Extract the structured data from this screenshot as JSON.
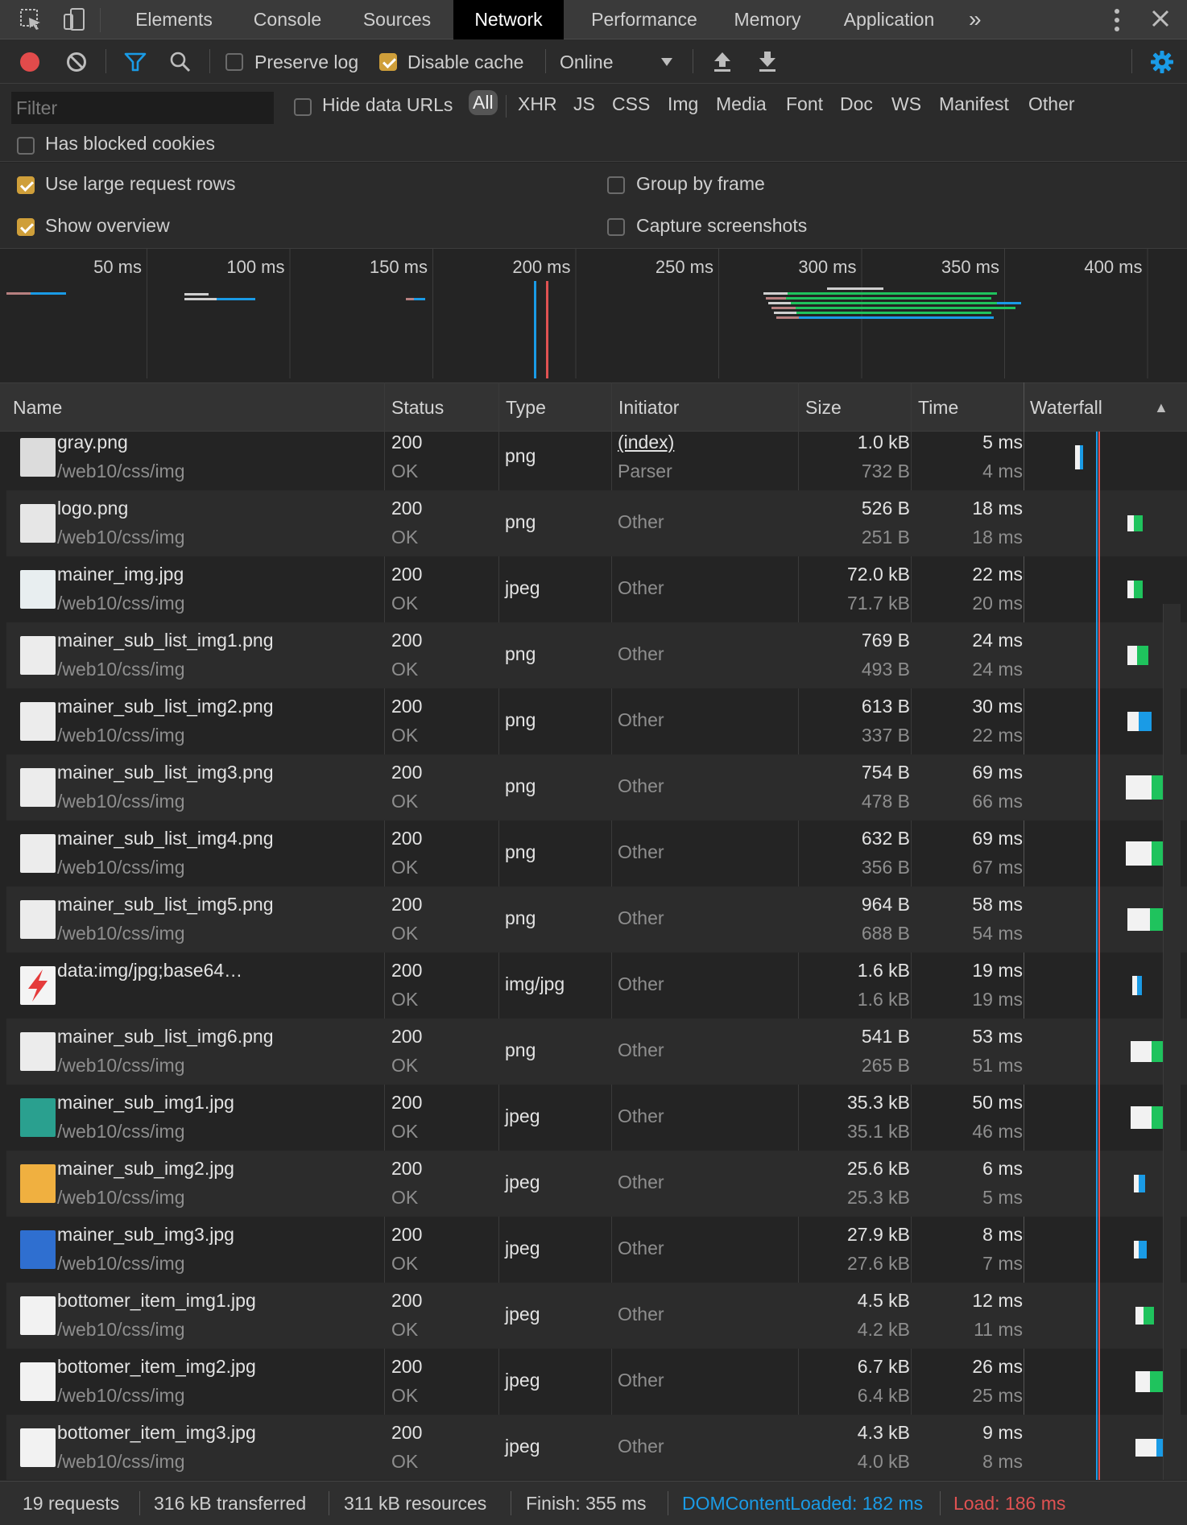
{
  "tabs": [
    "Elements",
    "Console",
    "Sources",
    "Network",
    "Performance",
    "Memory",
    "Application"
  ],
  "active_tab": "Network",
  "toolbar": {
    "preserve_log": {
      "label": "Preserve log",
      "checked": false
    },
    "disable_cache": {
      "label": "Disable cache",
      "checked": true
    },
    "throttling": "Online"
  },
  "filter": {
    "placeholder": "Filter",
    "hide_data_urls": {
      "label": "Hide data URLs",
      "checked": false
    },
    "types": [
      "All",
      "XHR",
      "JS",
      "CSS",
      "Img",
      "Media",
      "Font",
      "Doc",
      "WS",
      "Manifest",
      "Other"
    ],
    "active_type": "All",
    "has_blocked_cookies": {
      "label": "Has blocked cookies",
      "checked": false
    }
  },
  "settings": {
    "large_rows": {
      "label": "Use large request rows",
      "checked": true
    },
    "group_by_frame": {
      "label": "Group by frame",
      "checked": false
    },
    "show_overview": {
      "label": "Show overview",
      "checked": true
    },
    "capture_screenshots": {
      "label": "Capture screenshots",
      "checked": false
    }
  },
  "overview": {
    "tick_labels": [
      "50 ms",
      "100 ms",
      "150 ms",
      "200 ms",
      "250 ms",
      "300 ms",
      "350 ms",
      "400 ms"
    ],
    "dom_content_loaded_ms": 182,
    "load_ms": 186
  },
  "columns": [
    "Name",
    "Status",
    "Type",
    "Initiator",
    "Size",
    "Time",
    "Waterfall"
  ],
  "sort_indicator": "▲",
  "requests": [
    {
      "name": "gray.png",
      "path": "/web10/css/img",
      "status": "200",
      "status_text": "OK",
      "type": "png",
      "initiator": "(index)",
      "initiator_sub": "Parser",
      "size": "1.0 kB",
      "resource": "732 B",
      "time": "5 ms",
      "latency": "4 ms",
      "thumb": "#dcdcdc",
      "bar_color": "#1a9be6"
    },
    {
      "name": "logo.png",
      "path": "/web10/css/img",
      "status": "200",
      "status_text": "OK",
      "type": "png",
      "initiator": "Other",
      "initiator_sub": "",
      "size": "526 B",
      "resource": "251 B",
      "time": "18 ms",
      "latency": "18 ms",
      "thumb": "#e6e6e6",
      "bar_color": "#1fc35d"
    },
    {
      "name": "mainer_img.jpg",
      "path": "/web10/css/img",
      "status": "200",
      "status_text": "OK",
      "type": "jpeg",
      "initiator": "Other",
      "initiator_sub": "",
      "size": "72.0 kB",
      "resource": "71.7 kB",
      "time": "22 ms",
      "latency": "20 ms",
      "thumb": "#e8eef0",
      "bar_color": "#1fc35d"
    },
    {
      "name": "mainer_sub_list_img1.png",
      "path": "/web10/css/img",
      "status": "200",
      "status_text": "OK",
      "type": "png",
      "initiator": "Other",
      "initiator_sub": "",
      "size": "769 B",
      "resource": "493 B",
      "time": "24 ms",
      "latency": "24 ms",
      "thumb": "#ececec",
      "bar_color": "#1fc35d"
    },
    {
      "name": "mainer_sub_list_img2.png",
      "path": "/web10/css/img",
      "status": "200",
      "status_text": "OK",
      "type": "png",
      "initiator": "Other",
      "initiator_sub": "",
      "size": "613 B",
      "resource": "337 B",
      "time": "30 ms",
      "latency": "22 ms",
      "thumb": "#ececec",
      "bar_color": "#1a9be6"
    },
    {
      "name": "mainer_sub_list_img3.png",
      "path": "/web10/css/img",
      "status": "200",
      "status_text": "OK",
      "type": "png",
      "initiator": "Other",
      "initiator_sub": "",
      "size": "754 B",
      "resource": "478 B",
      "time": "69 ms",
      "latency": "66 ms",
      "thumb": "#ececec",
      "bar_color": "#1fc35d"
    },
    {
      "name": "mainer_sub_list_img4.png",
      "path": "/web10/css/img",
      "status": "200",
      "status_text": "OK",
      "type": "png",
      "initiator": "Other",
      "initiator_sub": "",
      "size": "632 B",
      "resource": "356 B",
      "time": "69 ms",
      "latency": "67 ms",
      "thumb": "#ececec",
      "bar_color": "#1fc35d"
    },
    {
      "name": "mainer_sub_list_img5.png",
      "path": "/web10/css/img",
      "status": "200",
      "status_text": "OK",
      "type": "png",
      "initiator": "Other",
      "initiator_sub": "",
      "size": "964 B",
      "resource": "688 B",
      "time": "58 ms",
      "latency": "54 ms",
      "thumb": "#ececec",
      "bar_color": "#1fc35d"
    },
    {
      "name": "data:img/jpg;base64…",
      "path": "",
      "status": "200",
      "status_text": "OK",
      "type": "img/jpg",
      "initiator": "Other",
      "initiator_sub": "",
      "size": "1.6 kB",
      "resource": "1.6 kB",
      "time": "19 ms",
      "latency": "19 ms",
      "thumb": "#f4f4f4",
      "bar_color": "#1a9be6"
    },
    {
      "name": "mainer_sub_list_img6.png",
      "path": "/web10/css/img",
      "status": "200",
      "status_text": "OK",
      "type": "png",
      "initiator": "Other",
      "initiator_sub": "",
      "size": "541 B",
      "resource": "265 B",
      "time": "53 ms",
      "latency": "51 ms",
      "thumb": "#ececec",
      "bar_color": "#1fc35d"
    },
    {
      "name": "mainer_sub_img1.jpg",
      "path": "/web10/css/img",
      "status": "200",
      "status_text": "OK",
      "type": "jpeg",
      "initiator": "Other",
      "initiator_sub": "",
      "size": "35.3 kB",
      "resource": "35.1 kB",
      "time": "50 ms",
      "latency": "46 ms",
      "thumb": "#2aa08f",
      "bar_color": "#1fc35d"
    },
    {
      "name": "mainer_sub_img2.jpg",
      "path": "/web10/css/img",
      "status": "200",
      "status_text": "OK",
      "type": "jpeg",
      "initiator": "Other",
      "initiator_sub": "",
      "size": "25.6 kB",
      "resource": "25.3 kB",
      "time": "6 ms",
      "latency": "5 ms",
      "thumb": "#f0b040",
      "bar_color": "#1a9be6"
    },
    {
      "name": "mainer_sub_img3.jpg",
      "path": "/web10/css/img",
      "status": "200",
      "status_text": "OK",
      "type": "jpeg",
      "initiator": "Other",
      "initiator_sub": "",
      "size": "27.9 kB",
      "resource": "27.6 kB",
      "time": "8 ms",
      "latency": "7 ms",
      "thumb": "#2f6fd0",
      "bar_color": "#1a9be6"
    },
    {
      "name": "bottomer_item_img1.jpg",
      "path": "/web10/css/img",
      "status": "200",
      "status_text": "OK",
      "type": "jpeg",
      "initiator": "Other",
      "initiator_sub": "",
      "size": "4.5 kB",
      "resource": "4.2 kB",
      "time": "12 ms",
      "latency": "11 ms",
      "thumb": "#f2f2f2",
      "bar_color": "#1fc35d"
    },
    {
      "name": "bottomer_item_img2.jpg",
      "path": "/web10/css/img",
      "status": "200",
      "status_text": "OK",
      "type": "jpeg",
      "initiator": "Other",
      "initiator_sub": "",
      "size": "6.7 kB",
      "resource": "6.4 kB",
      "time": "26 ms",
      "latency": "25 ms",
      "thumb": "#f2f2f2",
      "bar_color": "#1fc35d"
    },
    {
      "name": "bottomer_item_img3.jpg",
      "path": "/web10/css/img",
      "status": "200",
      "status_text": "OK",
      "type": "jpeg",
      "initiator": "Other",
      "initiator_sub": "",
      "size": "4.3 kB",
      "resource": "4.0 kB",
      "time": "9 ms",
      "latency": "8 ms",
      "thumb": "#f2f2f2",
      "bar_color": "#1a9be6"
    }
  ],
  "status_bar": {
    "requests": "19 requests",
    "transferred": "316 kB transferred",
    "resources": "311 kB resources",
    "finish": "Finish: 355 ms",
    "dom_content_loaded": "DOMContentLoaded: 182 ms",
    "load": "Load: 186 ms"
  },
  "colors": {
    "accent": "#1a73e8",
    "dcl_line": "#1a9be6",
    "load_line": "#e05252",
    "record": "#e24b4b",
    "checkbox_on": "#cf9f3a"
  }
}
